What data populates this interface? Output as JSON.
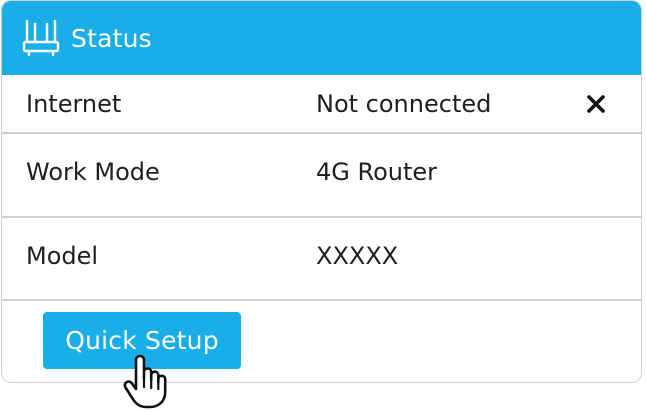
{
  "header": {
    "icon": "router-icon",
    "title": "Status"
  },
  "rows": [
    {
      "label": "Internet",
      "value": "Not connected",
      "status_icon": "close-icon"
    },
    {
      "label": "Work Mode",
      "value": "4G Router"
    },
    {
      "label": "Model",
      "value": "XXXXX"
    }
  ],
  "actions": {
    "quick_setup_label": "Quick Setup"
  },
  "cursor": "hand-pointer-icon",
  "colors": {
    "accent": "#1aaee8",
    "border": "#cfcfcf",
    "text": "#1f1f1f"
  }
}
